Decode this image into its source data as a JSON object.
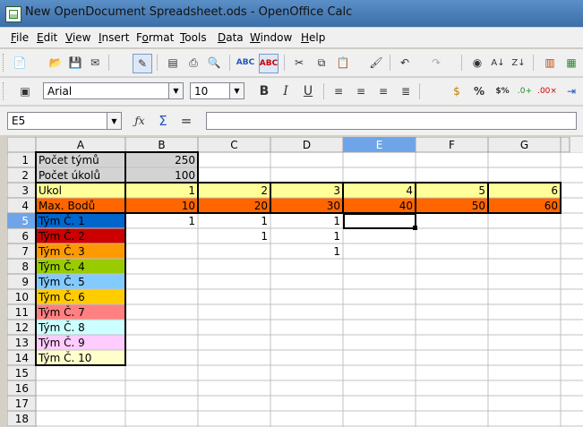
{
  "window": {
    "title": "New OpenDocument Spreadsheet.ods - OpenOffice Calc"
  },
  "menu": [
    "File",
    "Edit",
    "View",
    "Insert",
    "Format",
    "Tools",
    "Data",
    "Window",
    "Help"
  ],
  "menu_underline": [
    "F",
    "E",
    "V",
    "I",
    "o",
    "T",
    "D",
    "W",
    "H"
  ],
  "format_toolbar": {
    "font_name": "Arial",
    "font_size": "10"
  },
  "formula_bar": {
    "name_box": "E5",
    "formula": ""
  },
  "sheet": {
    "columns": [
      "A",
      "B",
      "C",
      "D",
      "E",
      "F",
      "G"
    ],
    "rows": [
      "1",
      "2",
      "3",
      "4",
      "5",
      "6",
      "7",
      "8",
      "9",
      "10",
      "11",
      "12",
      "13",
      "14",
      "15",
      "16",
      "17",
      "18"
    ],
    "active_cell": "E5",
    "cells": [
      {
        "r": 1,
        "c": 0,
        "text": "Počet týmů",
        "fill": "#d3d3d3",
        "align": "left"
      },
      {
        "r": 1,
        "c": 1,
        "text": "250",
        "fill": "#d3d3d3",
        "align": "right"
      },
      {
        "r": 2,
        "c": 0,
        "text": "Počet úkolů",
        "fill": "#d3d3d3",
        "align": "left"
      },
      {
        "r": 2,
        "c": 1,
        "text": "100",
        "fill": "#d3d3d3",
        "align": "right"
      },
      {
        "r": 3,
        "c": 0,
        "text": "Ukol",
        "fill": "#ffff99",
        "align": "left"
      },
      {
        "r": 3,
        "c": 1,
        "text": "1",
        "fill": "#ffff99",
        "align": "right"
      },
      {
        "r": 3,
        "c": 2,
        "text": "2",
        "fill": "#ffff99",
        "align": "right"
      },
      {
        "r": 3,
        "c": 3,
        "text": "3",
        "fill": "#ffff99",
        "align": "right"
      },
      {
        "r": 3,
        "c": 4,
        "text": "4",
        "fill": "#ffff99",
        "align": "right"
      },
      {
        "r": 3,
        "c": 5,
        "text": "5",
        "fill": "#ffff99",
        "align": "right"
      },
      {
        "r": 3,
        "c": 6,
        "text": "6",
        "fill": "#ffff99",
        "align": "right"
      },
      {
        "r": 4,
        "c": 0,
        "text": "Max. Bodů",
        "fill": "#ff6600",
        "align": "left"
      },
      {
        "r": 4,
        "c": 1,
        "text": "10",
        "fill": "#ff6600",
        "align": "right"
      },
      {
        "r": 4,
        "c": 2,
        "text": "20",
        "fill": "#ff6600",
        "align": "right"
      },
      {
        "r": 4,
        "c": 3,
        "text": "30",
        "fill": "#ff6600",
        "align": "right"
      },
      {
        "r": 4,
        "c": 4,
        "text": "40",
        "fill": "#ff6600",
        "align": "right"
      },
      {
        "r": 4,
        "c": 5,
        "text": "50",
        "fill": "#ff6600",
        "align": "right"
      },
      {
        "r": 4,
        "c": 6,
        "text": "60",
        "fill": "#ff6600",
        "align": "right"
      },
      {
        "r": 5,
        "c": 0,
        "text": "Tým Č. 1",
        "fill": "#0066cc",
        "align": "left"
      },
      {
        "r": 5,
        "c": 1,
        "text": "1",
        "fill": "",
        "align": "right"
      },
      {
        "r": 5,
        "c": 2,
        "text": "1",
        "fill": "",
        "align": "right"
      },
      {
        "r": 5,
        "c": 3,
        "text": "1",
        "fill": "",
        "align": "right"
      },
      {
        "r": 6,
        "c": 0,
        "text": "Tým Č. 2",
        "fill": "#cc0000",
        "align": "left"
      },
      {
        "r": 6,
        "c": 2,
        "text": "1",
        "fill": "",
        "align": "right"
      },
      {
        "r": 6,
        "c": 3,
        "text": "1",
        "fill": "",
        "align": "right"
      },
      {
        "r": 7,
        "c": 0,
        "text": "Tým Č. 3",
        "fill": "#ff9900",
        "align": "left"
      },
      {
        "r": 7,
        "c": 3,
        "text": "1",
        "fill": "",
        "align": "right"
      },
      {
        "r": 8,
        "c": 0,
        "text": "Tým Č. 4",
        "fill": "#99cc00",
        "align": "left"
      },
      {
        "r": 9,
        "c": 0,
        "text": "Tým Č. 5",
        "fill": "#83caff",
        "align": "left"
      },
      {
        "r": 10,
        "c": 0,
        "text": "Tým Č. 6",
        "fill": "#ffcc00",
        "align": "left"
      },
      {
        "r": 11,
        "c": 0,
        "text": "Tým Č. 7",
        "fill": "#ff8080",
        "align": "left"
      },
      {
        "r": 12,
        "c": 0,
        "text": "Tým Č. 8",
        "fill": "#ccffff",
        "align": "left"
      },
      {
        "r": 13,
        "c": 0,
        "text": "Tým Č. 9",
        "fill": "#ffccff",
        "align": "left"
      },
      {
        "r": 14,
        "c": 0,
        "text": "Tým Č. 10",
        "fill": "#ffffcc",
        "align": "left"
      }
    ]
  },
  "icons": {
    "toolbar1": [
      "new-icon",
      "open-icon",
      "save-icon",
      "email-icon",
      "edit-file-icon",
      "export-pdf-icon",
      "print-icon",
      "page-preview-icon",
      "spellcheck-icon",
      "autospellcheck-icon",
      "cut-icon",
      "copy-icon",
      "paste-icon",
      "clone-formatting-icon",
      "undo-icon",
      "redo-icon",
      "navigator-icon",
      "sort-ascending-icon",
      "sort-descending-icon",
      "chart-icon"
    ],
    "toolbar2": [
      "styles-icon",
      "bold-icon",
      "italic-icon",
      "underline-icon",
      "align-left-icon",
      "align-center-icon",
      "align-right-icon",
      "justify-icon",
      "merge-cells-icon",
      "percent-icon",
      "currency-icon",
      "add-decimal-icon",
      "delete-decimal-icon"
    ],
    "formula": [
      "function-wizard-icon",
      "sum-icon",
      "equals-icon"
    ]
  }
}
